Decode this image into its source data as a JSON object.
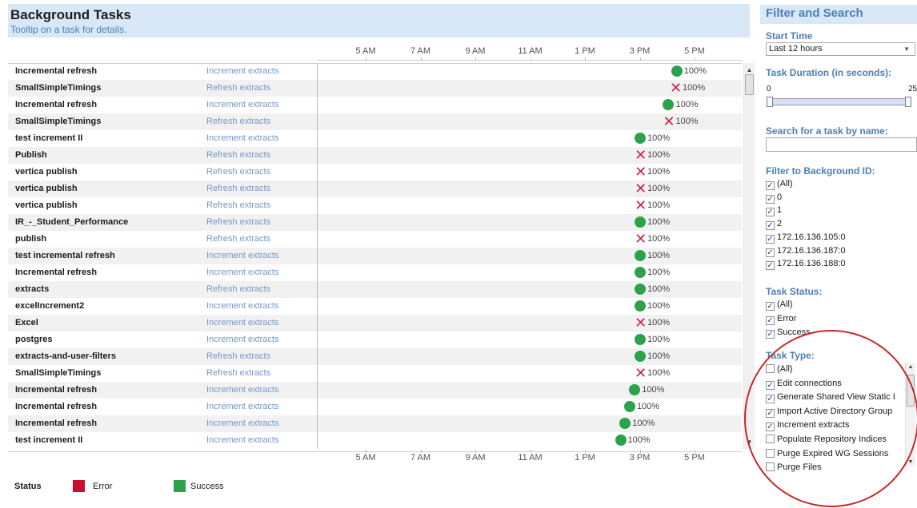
{
  "header": {
    "title": "Background Tasks",
    "subtitle": "Tooltip on a task for details."
  },
  "axis": {
    "ticks": [
      "5 AM",
      "7 AM",
      "9 AM",
      "11 AM",
      "1 PM",
      "3 PM",
      "5 PM"
    ]
  },
  "tasks": [
    {
      "name": "Incremental refresh",
      "type": "Increment extracts",
      "status": "success",
      "time": "4:21 PM",
      "percent": "100%"
    },
    {
      "name": "SmallSimpleTimings",
      "type": "Refresh extracts",
      "status": "error",
      "time": "4:18 PM",
      "percent": "100%"
    },
    {
      "name": "Incremental refresh",
      "type": "Increment extracts",
      "status": "success",
      "time": "4:03 PM",
      "percent": "100%"
    },
    {
      "name": "SmallSimpleTimings",
      "type": "Refresh extracts",
      "status": "error",
      "time": "4:03 PM",
      "percent": "100%"
    },
    {
      "name": "test increment II",
      "type": "Increment extracts",
      "status": "success",
      "time": "3:01 PM",
      "percent": "100%"
    },
    {
      "name": "Publish",
      "type": "Refresh extracts",
      "status": "error",
      "time": "3:01 PM",
      "percent": "100%"
    },
    {
      "name": "vertica publish",
      "type": "Refresh extracts",
      "status": "error",
      "time": "3:01 PM",
      "percent": "100%"
    },
    {
      "name": "vertica publish",
      "type": "Refresh extracts",
      "status": "error",
      "time": "3:01 PM",
      "percent": "100%"
    },
    {
      "name": "vertica publish",
      "type": "Refresh extracts",
      "status": "error",
      "time": "3:01 PM",
      "percent": "100%"
    },
    {
      "name": "IR_-_Student_Performance",
      "type": "Refresh extracts",
      "status": "success",
      "time": "3:01 PM",
      "percent": "100%"
    },
    {
      "name": "publish",
      "type": "Refresh extracts",
      "status": "error",
      "time": "3:01 PM",
      "percent": "100%"
    },
    {
      "name": "test incremental refresh",
      "type": "Increment extracts",
      "status": "success",
      "time": "3:01 PM",
      "percent": "100%"
    },
    {
      "name": "Incremental refresh",
      "type": "Increment extracts",
      "status": "success",
      "time": "3:01 PM",
      "percent": "100%"
    },
    {
      "name": "extracts",
      "type": "Refresh extracts",
      "status": "success",
      "time": "3:01 PM",
      "percent": "100%"
    },
    {
      "name": "excelIncrement2",
      "type": "Increment extracts",
      "status": "success",
      "time": "3:01 PM",
      "percent": "100%"
    },
    {
      "name": "Excel",
      "type": "Increment extracts",
      "status": "error",
      "time": "3:01 PM",
      "percent": "100%"
    },
    {
      "name": "postgres",
      "type": "Increment extracts",
      "status": "success",
      "time": "3:01 PM",
      "percent": "100%"
    },
    {
      "name": "extracts-and-user-filters",
      "type": "Refresh extracts",
      "status": "success",
      "time": "3:01 PM",
      "percent": "100%"
    },
    {
      "name": "SmallSimpleTimings",
      "type": "Refresh extracts",
      "status": "error",
      "time": "3:01 PM",
      "percent": "100%"
    },
    {
      "name": "Incremental refresh",
      "type": "Increment extracts",
      "status": "success",
      "time": "2:49 PM",
      "percent": "100%"
    },
    {
      "name": "Incremental refresh",
      "type": "Increment extracts",
      "status": "success",
      "time": "2:38 PM",
      "percent": "100%"
    },
    {
      "name": "Incremental refresh",
      "type": "Increment extracts",
      "status": "success",
      "time": "2:28 PM",
      "percent": "100%"
    },
    {
      "name": "test increment II",
      "type": "Increment extracts",
      "status": "success",
      "time": "2:18 PM",
      "percent": "100%"
    }
  ],
  "legend": {
    "title": "Status",
    "items": [
      {
        "label": "Error",
        "color": "#c8102e"
      },
      {
        "label": "Success",
        "color": "#2ca24b"
      }
    ]
  },
  "panel": {
    "title": "Filter and Search",
    "start_time": {
      "label": "Start Time",
      "value": "Last 12 hours"
    },
    "duration": {
      "label": "Task Duration (in seconds):",
      "min": "0",
      "max": "25"
    },
    "search": {
      "label": "Search for a task by name:",
      "value": ""
    },
    "background_id": {
      "label": "Filter to Background ID:",
      "options": [
        {
          "label": "(All)",
          "checked": true
        },
        {
          "label": "0",
          "checked": true
        },
        {
          "label": "1",
          "checked": true
        },
        {
          "label": "2",
          "checked": true
        },
        {
          "label": "172.16.136.105:0",
          "checked": true
        },
        {
          "label": "172.16.136.187:0",
          "checked": true
        },
        {
          "label": "172.16.136.188:0",
          "checked": true
        }
      ]
    },
    "task_status": {
      "label": "Task Status:",
      "options": [
        {
          "label": "(All)",
          "checked": true
        },
        {
          "label": "Error",
          "checked": true
        },
        {
          "label": "Success",
          "checked": true
        }
      ]
    },
    "task_type": {
      "label": "Task Type:",
      "options": [
        {
          "label": "(All)",
          "checked": false
        },
        {
          "label": "Edit connections",
          "checked": true
        },
        {
          "label": "Generate Shared View Static I",
          "checked": true
        },
        {
          "label": "Import Active Directory Group",
          "checked": true
        },
        {
          "label": "Increment extracts",
          "checked": true
        },
        {
          "label": "Populate Repository Indices",
          "checked": false
        },
        {
          "label": "Purge Expired WG Sessions",
          "checked": false
        },
        {
          "label": "Purge Files",
          "checked": false
        }
      ]
    }
  }
}
